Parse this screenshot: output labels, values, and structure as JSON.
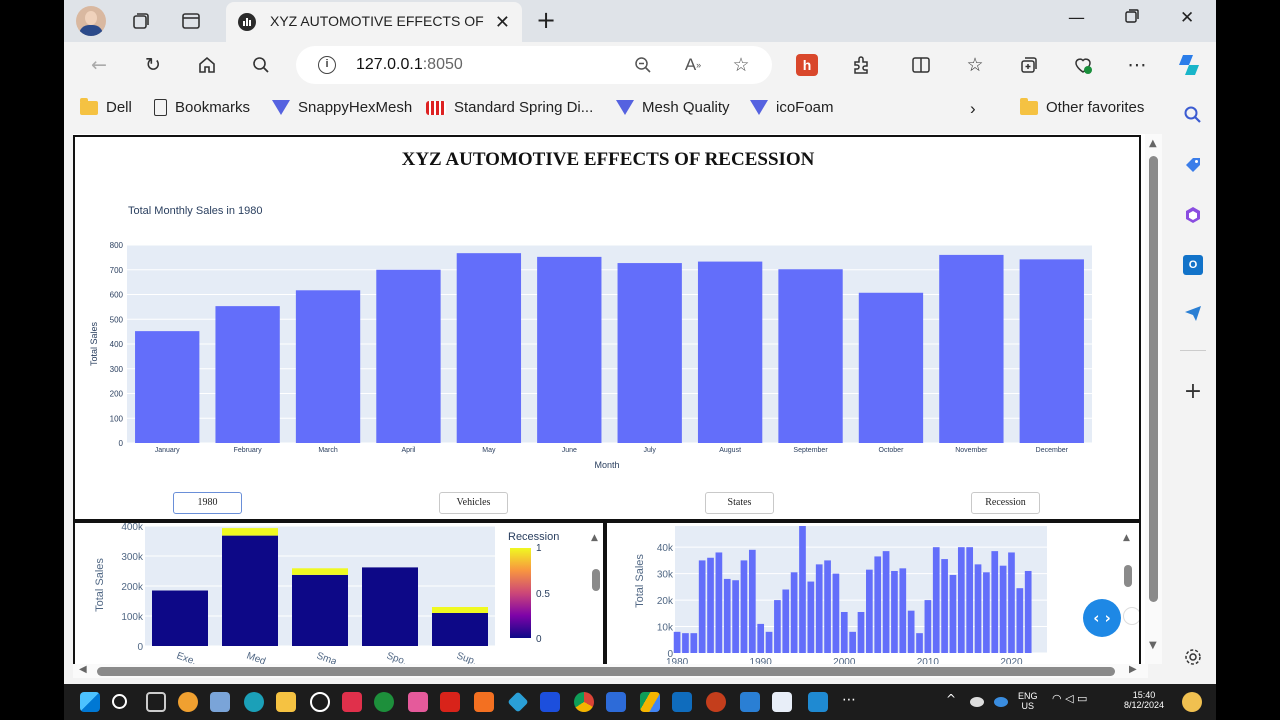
{
  "browser": {
    "tab_title": "XYZ AUTOMOTIVE EFFECTS OF RECESSION",
    "url_host": "127.0.0.1",
    "url_port": ":8050",
    "favorites": [
      {
        "label": "Dell",
        "icon": "folder-icon"
      },
      {
        "label": "Bookmarks",
        "icon": "page-icon"
      },
      {
        "label": "SnappyHexMesh",
        "icon": "triangle-icon"
      },
      {
        "label": "Standard Spring Di...",
        "icon": "spring-icon"
      },
      {
        "label": "Mesh Quality",
        "icon": "triangle-icon"
      },
      {
        "label": "icoFoam",
        "icon": "triangle-icon"
      }
    ],
    "other_favorites": "Other favorites"
  },
  "page": {
    "heading": "XYZ AUTOMOTIVE EFFECTS OF RECESSION",
    "buttons": [
      "1980",
      "Vehicles",
      "States",
      "Recession"
    ],
    "active_button": "1980"
  },
  "main_chart": {
    "title": "Total Monthly Sales in 1980",
    "xlabel": "Month",
    "ylabel": "Total Sales",
    "yticks": [
      "800",
      "700",
      "600",
      "500",
      "400",
      "300",
      "200",
      "100",
      "0"
    ],
    "color": "#636efa",
    "plot_bg": "#e5ecf6"
  },
  "lower_left": {
    "ylabel": "Total Sales",
    "yticks": [
      "400k",
      "300k",
      "200k",
      "100k",
      "0"
    ],
    "xticks": [
      "Exe...",
      "Med...",
      "Sma...",
      "Spo...",
      "Sup..."
    ],
    "legend_title": "Recession",
    "legend_ticks": [
      "1",
      "0.5",
      "0"
    ]
  },
  "lower_right": {
    "ylabel": "Total Sales",
    "yticks": [
      "40k",
      "30k",
      "20k",
      "10k",
      "0"
    ],
    "xticks": [
      "1980",
      "1990",
      "2000",
      "2010",
      "2020"
    ]
  },
  "chart_data": [
    {
      "type": "bar",
      "title": "Total Monthly Sales in 1980",
      "xlabel": "Month",
      "ylabel": "Total Sales",
      "ylim": [
        0,
        800
      ],
      "categories": [
        "January",
        "February",
        "March",
        "April",
        "May",
        "June",
        "July",
        "August",
        "September",
        "October",
        "November",
        "December"
      ],
      "values": [
        452,
        553,
        617,
        700,
        767,
        752,
        727,
        733,
        702,
        607,
        760,
        742
      ]
    },
    {
      "type": "bar",
      "ylabel": "Total Sales",
      "ylim": [
        0,
        400000
      ],
      "categories": [
        "Exe...",
        "Med...",
        "Sma...",
        "Spo...",
        "Sup..."
      ],
      "series": [
        {
          "name": "0",
          "values": [
            185000,
            368000,
            237000,
            262000,
            110000
          ]
        },
        {
          "name": "1",
          "values": [
            0,
            25000,
            22000,
            0,
            20000
          ]
        }
      ],
      "legend_title": "Recession",
      "colorscale": [
        "#0d0887",
        "#f0f921"
      ]
    },
    {
      "type": "bar",
      "ylabel": "Total Sales",
      "ylim": [
        0,
        48000
      ],
      "x": [
        1980,
        1981,
        1982,
        1983,
        1984,
        1985,
        1986,
        1987,
        1988,
        1989,
        1990,
        1991,
        1992,
        1993,
        1994,
        1995,
        1996,
        1997,
        1998,
        1999,
        2000,
        2001,
        2002,
        2003,
        2004,
        2005,
        2006,
        2007,
        2008,
        2009,
        2010,
        2011,
        2012,
        2013,
        2014,
        2015,
        2016,
        2017,
        2018,
        2019,
        2020,
        2021,
        2022,
        2023
      ],
      "values": [
        8000,
        7500,
        7500,
        35000,
        36000,
        38000,
        28000,
        27500,
        35000,
        39000,
        11000,
        8000,
        20000,
        24000,
        30500,
        48000,
        27000,
        33500,
        35000,
        30000,
        15500,
        8000,
        15500,
        31500,
        36500,
        38500,
        31000,
        32000,
        16000,
        7500,
        20000,
        40000,
        35500,
        29500,
        40000,
        40000,
        33500,
        30500,
        38500,
        33000,
        38000,
        24500,
        31000,
        0
      ]
    }
  ]
}
